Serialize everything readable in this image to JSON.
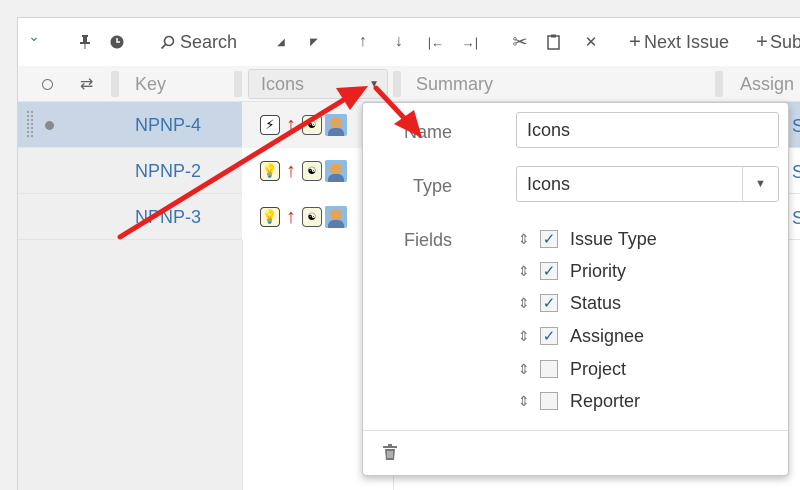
{
  "toolbar": {
    "search_label": "Search",
    "next_issue_label": "Next Issue",
    "sub_label": "Sub"
  },
  "columns": {
    "key": "Key",
    "icons": "Icons",
    "summary": "Summary",
    "assignee": "Assign"
  },
  "rows": [
    {
      "key": "NPNP-4",
      "type_icon": "lightning-icon",
      "selected": true
    },
    {
      "key": "NPNP-2",
      "type_icon": "lightbulb-icon",
      "selected": false
    },
    {
      "key": "NPNP-3",
      "type_icon": "lightbulb-icon",
      "selected": false
    }
  ],
  "popup": {
    "name_label": "Name",
    "name_value": "Icons",
    "type_label": "Type",
    "type_value": "Icons",
    "fields_label": "Fields",
    "fields": [
      {
        "label": "Issue Type",
        "checked": true
      },
      {
        "label": "Priority",
        "checked": true
      },
      {
        "label": "Status",
        "checked": true
      },
      {
        "label": "Assignee",
        "checked": true
      },
      {
        "label": "Project",
        "checked": false
      },
      {
        "label": "Reporter",
        "checked": false
      }
    ]
  },
  "colors": {
    "annotation_arrow": "#e8201e",
    "link": "#3b73af",
    "priority": "#c8281c",
    "selected_row": "#c9d6e6"
  }
}
